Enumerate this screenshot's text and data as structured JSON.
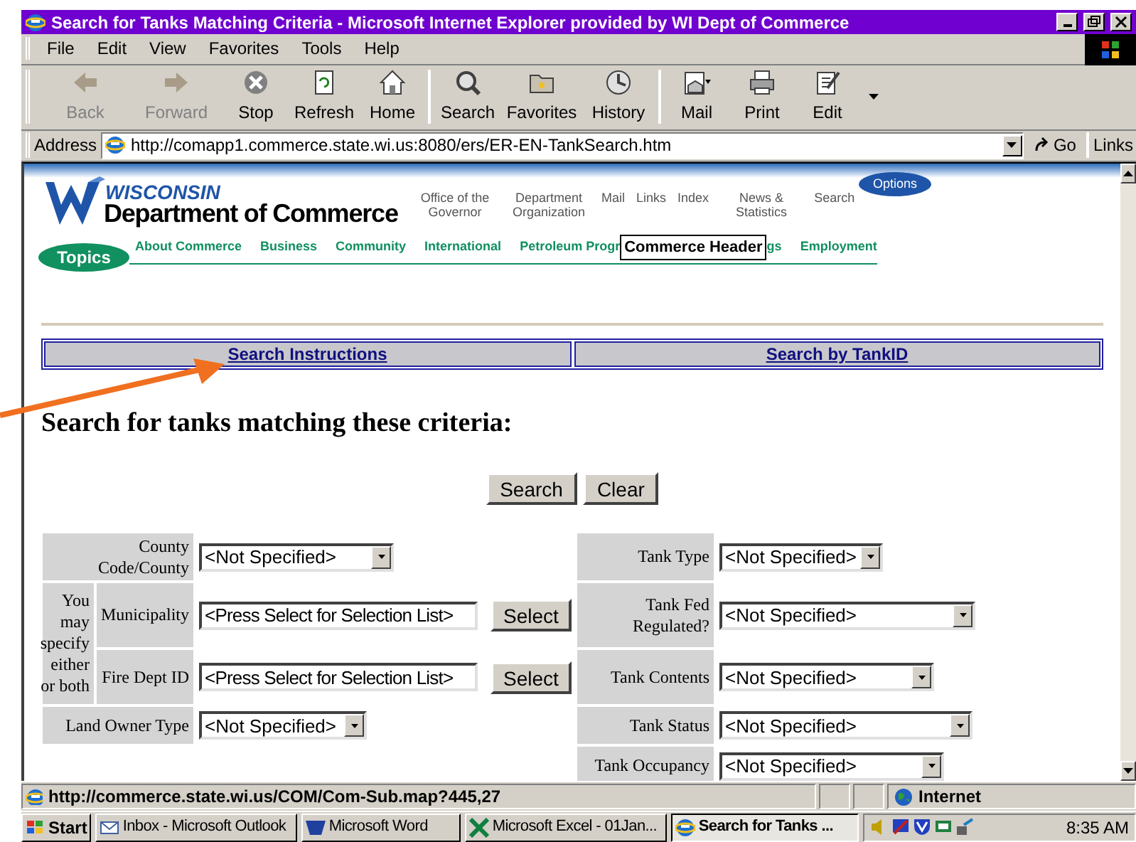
{
  "window": {
    "title": "Search for Tanks Matching Criteria - Microsoft Internet Explorer provided by WI Dept of Commerce"
  },
  "menu": [
    "File",
    "Edit",
    "View",
    "Favorites",
    "Tools",
    "Help"
  ],
  "toolbar": [
    {
      "label": "Back",
      "disabled": true
    },
    {
      "label": "Forward",
      "disabled": true
    },
    {
      "label": "Stop",
      "disabled": false
    },
    {
      "label": "Refresh",
      "disabled": false
    },
    {
      "label": "Home",
      "disabled": false
    },
    {
      "label": "Search",
      "disabled": false
    },
    {
      "label": "Favorites",
      "disabled": false
    },
    {
      "label": "History",
      "disabled": false
    },
    {
      "label": "Mail",
      "disabled": false
    },
    {
      "label": "Print",
      "disabled": false
    },
    {
      "label": "Edit",
      "disabled": false
    }
  ],
  "address": {
    "label": "Address",
    "url": "http://comapp1.commerce.state.wi.us:8080/ers/ER-EN-TankSearch.htm",
    "go": "Go",
    "links": "Links"
  },
  "header": {
    "state": "WISCONSIN",
    "agency": "Department of Commerce",
    "options": "Options",
    "topics_label": "Topics",
    "tooltip": "Commerce Header",
    "nav": [
      "Office of the Governor",
      "Department Organization",
      "Mail",
      "Links",
      "Index",
      "News & Statistics",
      "Search"
    ],
    "topics": [
      "About Commerce",
      "Business",
      "Community",
      "International",
      "Petroleum Progr",
      "gs",
      "Employment"
    ]
  },
  "tabs": [
    "Search Instructions",
    "Search by TankID"
  ],
  "heading": "Search for tanks matching these criteria:",
  "buttons": [
    "Search",
    "Clear"
  ],
  "left_fields": [
    {
      "kind": "select",
      "label": "County Code/County",
      "value": "<Not Specified>"
    },
    {
      "kind": "group",
      "note": "You may specify either or both",
      "fields": [
        {
          "label": "Municipality",
          "value": "<Press Select for Selection List>",
          "button": "Select"
        },
        {
          "label": "Fire Dept ID",
          "value": "<Press Select for Selection List>",
          "button": "Select"
        }
      ]
    },
    {
      "kind": "select",
      "label": "Land Owner Type",
      "value": "<Not Specified>"
    }
  ],
  "right_fields": [
    {
      "label": "Tank Type",
      "value": "<Not Specified>"
    },
    {
      "label": "Tank Fed Regulated?",
      "value": "<Not Specified>"
    },
    {
      "label": "Tank Contents",
      "value": "<Not Specified>"
    },
    {
      "label": "Tank Status",
      "value": "<Not Specified>"
    },
    {
      "label": "Tank Occupancy",
      "value": "<Not Specified>"
    }
  ],
  "status_bar": {
    "url": "http://commerce.state.wi.us/COM/Com-Sub.map?445,27",
    "zone": "Internet"
  },
  "taskbar": {
    "start": "Start",
    "tasks": [
      {
        "label": "Inbox - Microsoft Outlook",
        "selected": false
      },
      {
        "label": "Microsoft Word",
        "selected": false
      },
      {
        "label": "Microsoft Excel - 01Jan...",
        "selected": false
      },
      {
        "label": "Search for Tanks ...",
        "selected": true
      }
    ],
    "clock": "8:35 AM"
  }
}
